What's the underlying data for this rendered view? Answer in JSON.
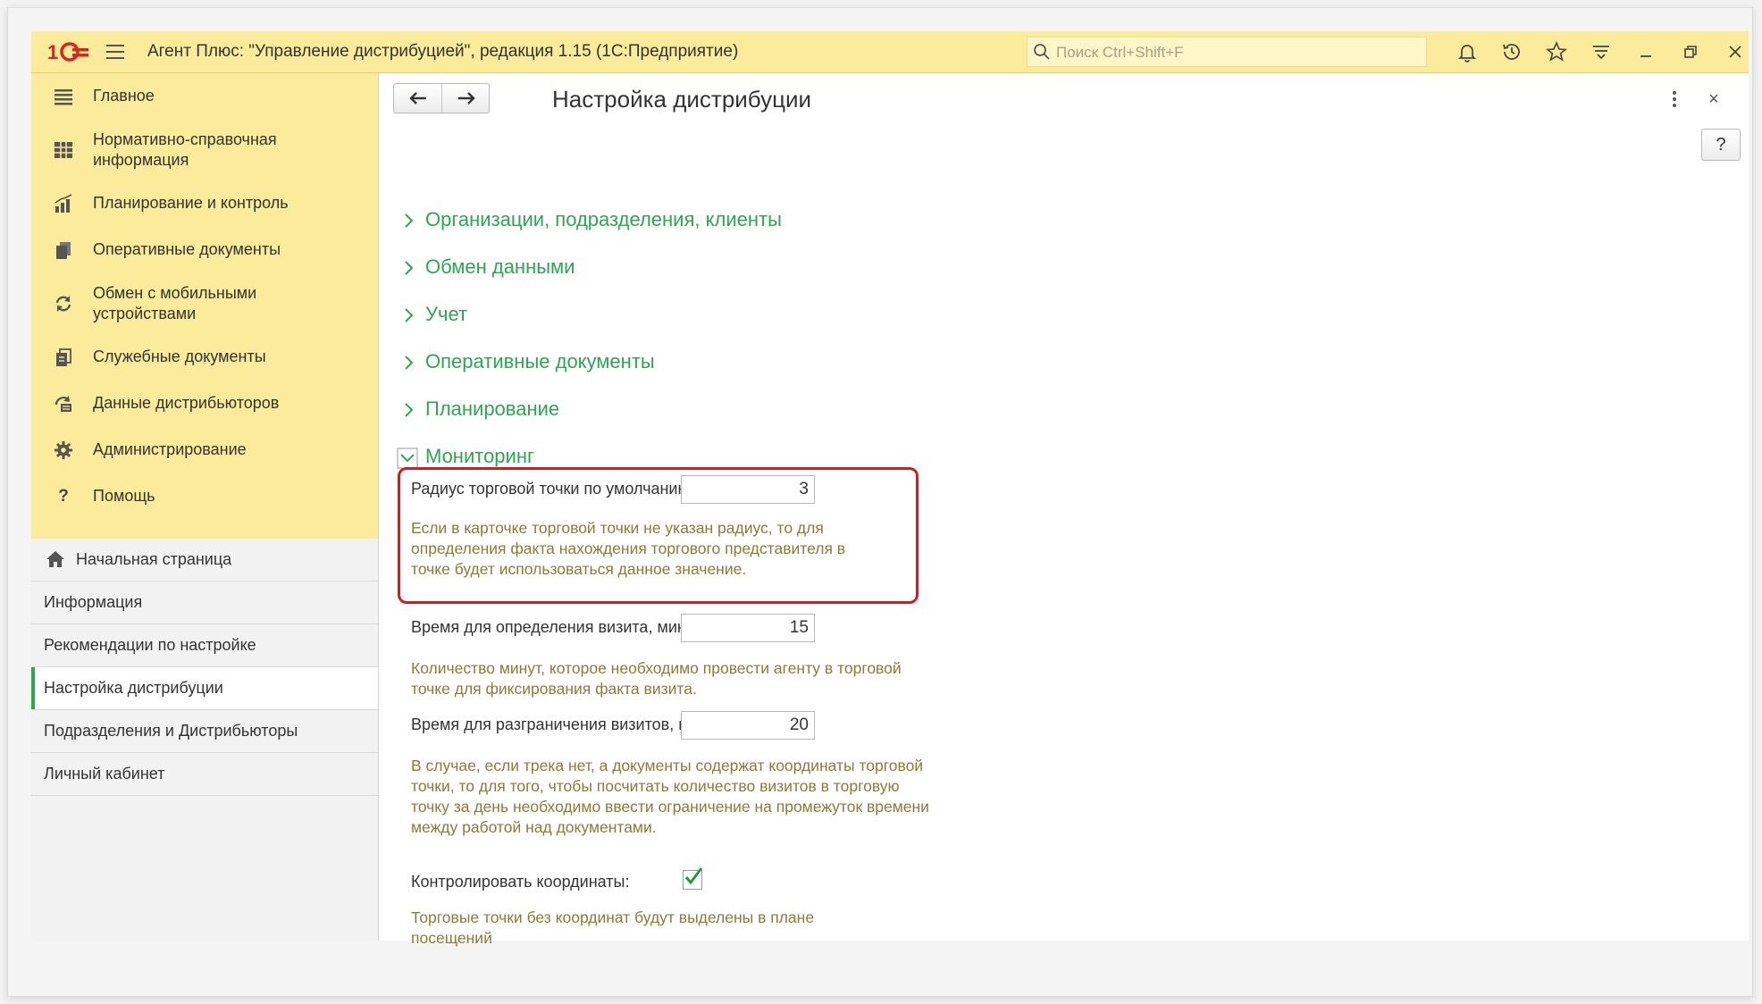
{
  "app": {
    "title": "Агент Плюс: \"Управление дистрибуцией\", редакция 1.15  (1С:Предприятие)",
    "search_placeholder": "Поиск Ctrl+Shift+F"
  },
  "sections": [
    {
      "label": "Главное",
      "icon": "list-icon"
    },
    {
      "label": "Нормативно-справочная информация",
      "icon": "grid-icon"
    },
    {
      "label": "Планирование и контроль",
      "icon": "chart-icon"
    },
    {
      "label": "Оперативные документы",
      "icon": "documents-icon"
    },
    {
      "label": "Обмен с мобильными устройствами",
      "icon": "sync-icon"
    },
    {
      "label": "Служебные документы",
      "icon": "service-docs-icon"
    },
    {
      "label": "Данные дистрибьюторов",
      "icon": "distributor-data-icon"
    },
    {
      "label": "Администрирование",
      "icon": "gear-icon"
    },
    {
      "label": "Помощь",
      "icon": "question-icon"
    }
  ],
  "nav": [
    {
      "label": "Начальная страница",
      "icon": "home-icon"
    },
    {
      "label": "Информация"
    },
    {
      "label": "Рекомендации по настройке"
    },
    {
      "label": "Настройка дистрибуции",
      "active": true
    },
    {
      "label": "Подразделения и Дистрибьюторы"
    },
    {
      "label": "Личный кабинет"
    }
  ],
  "form": {
    "title": "Настройка дистрибуции",
    "help_label": "?",
    "close_label": "×",
    "groups": [
      {
        "label": "Организации, подразделения, клиенты",
        "expanded": false
      },
      {
        "label": "Обмен данными",
        "expanded": false
      },
      {
        "label": "Учет",
        "expanded": false
      },
      {
        "label": "Оперативные документы",
        "expanded": false
      },
      {
        "label": "Планирование",
        "expanded": false
      },
      {
        "label": "Мониторинг",
        "expanded": true
      }
    ],
    "monitoring": {
      "radius_label": "Радиус торговой точки по умолчанию, м:",
      "radius_value": "3",
      "radius_hint": "Если в карточке торговой точки не указан радиус, то для определения факта нахождения торгового представителя в точке будет использоваться данное значение.",
      "visit_time_label": "Время для определения визита, мин.:",
      "visit_time_value": "15",
      "visit_time_hint": "Количество минут, которое необходимо провести агенту в торговой точке для фиксирования факта визита.",
      "visit_gap_label": "Время для разграничения визитов, мин.:",
      "visit_gap_value": "20",
      "visit_gap_hint": "В случае, если трека нет, а документы содержат координаты торговой точки, то для того, чтобы посчитать количество визитов в торговую точку за день необходимо ввести ограничение на промежуток времени между работой над документами.",
      "control_coords_label": "Контролировать координаты:",
      "control_coords_checked": true,
      "control_coords_hint": "Торговые точки без координат будут выделены в плане посещений"
    }
  },
  "colors": {
    "topbar": "#fbeb9a",
    "accent_green": "#2ea651",
    "hint_text": "#8c7b38",
    "highlight_red": "#d91a1a"
  }
}
